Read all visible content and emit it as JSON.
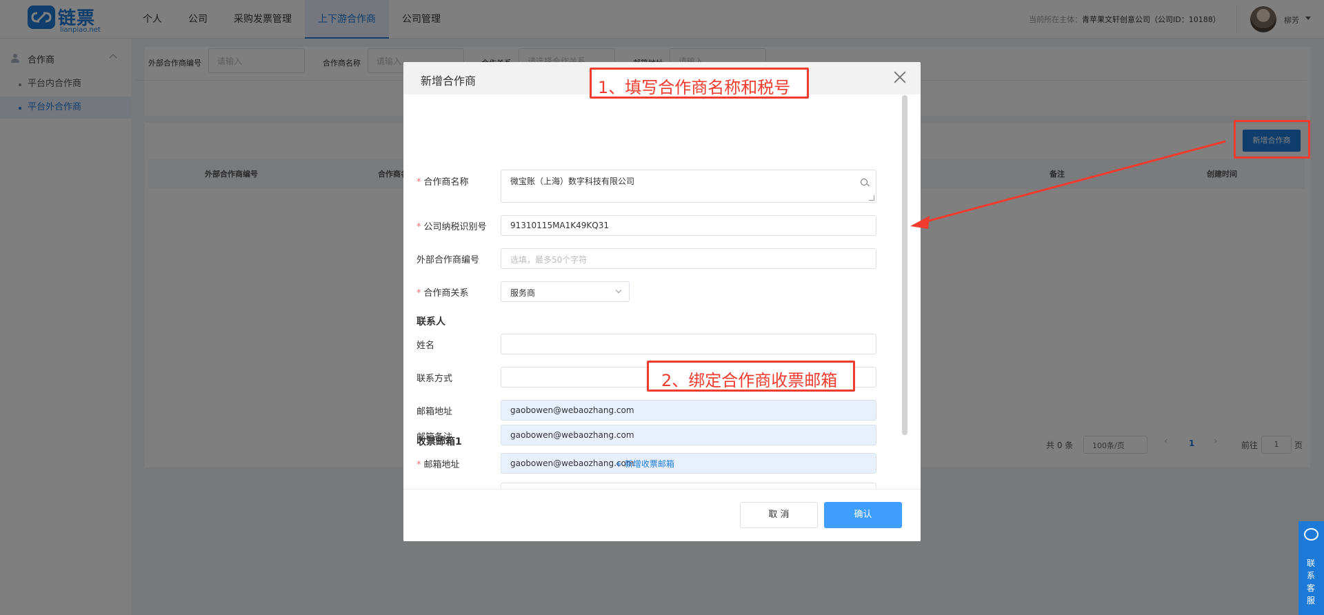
{
  "logo": {
    "name": "链票",
    "sub": "lianpiao.net"
  },
  "nav": [
    "个人",
    "公司",
    "采购发票管理",
    "上下游合作商",
    "公司管理"
  ],
  "header": {
    "entity_prefix": "当前所在主体：",
    "entity_name": "青苹果文轩创意公司（公司ID：10188）",
    "user_name": "柳芳"
  },
  "sidebar": {
    "section": "合作商",
    "items": [
      {
        "label": "平台内合作商"
      },
      {
        "label": "平台外合作商"
      }
    ]
  },
  "filters": [
    {
      "label": "外部合作商编号",
      "placeholder": "请输入"
    },
    {
      "label": "合作商名称",
      "placeholder": "请输入"
    },
    {
      "label": "合作关系",
      "placeholder": "请选择合作关系"
    },
    {
      "label": "邮箱地址",
      "placeholder": "请输入"
    }
  ],
  "toolbar": {
    "add_partner": "新增合作商"
  },
  "table": {
    "columns": [
      "外部合作商编号",
      "合作商名称",
      "备注",
      "创建时间"
    ]
  },
  "pagination": {
    "total": "共 0 条",
    "page_size": "100条/页",
    "current": "1",
    "goto_label": "前往",
    "goto_value": "1",
    "page_suffix": "页"
  },
  "dialog": {
    "title": "新增合作商",
    "fields": {
      "partner_name_label": "合作商名称",
      "partner_name_value": "微宝账（上海）数字科技有限公司",
      "tax_id_label": "公司纳税识别号",
      "tax_id_value": "91310115MA1K49KQ31",
      "external_no_label": "外部合作商编号",
      "external_no_placeholder": "选填，最多50个字符",
      "relation_label": "合作商关系",
      "relation_value": "服务商"
    },
    "contact": {
      "section": "联系人",
      "name_label": "姓名",
      "phone_label": "联系方式",
      "email_label": "邮箱地址",
      "email_value": "gaobowen@webaozhang.com"
    },
    "invoice_email": {
      "section": "收票邮箱1",
      "email_label": "邮箱地址",
      "email_value": "gaobowen@webaozhang.com",
      "note_label": "邮箱备注",
      "note_value": "gaobowen@webaozhang.com",
      "add_link": "+ 新增收票邮箱"
    },
    "cancel": "取 消",
    "confirm": "确认"
  },
  "annotations": {
    "step1": "1、填写合作商名称和税号",
    "step2": "2、绑定合作商收票邮箱"
  },
  "service": {
    "label": "联系客服"
  },
  "colors": {
    "accent": "#1e7ad9",
    "primary_button": "#409eff",
    "annotation": "#f03c2e",
    "required": "#f56c6c"
  }
}
